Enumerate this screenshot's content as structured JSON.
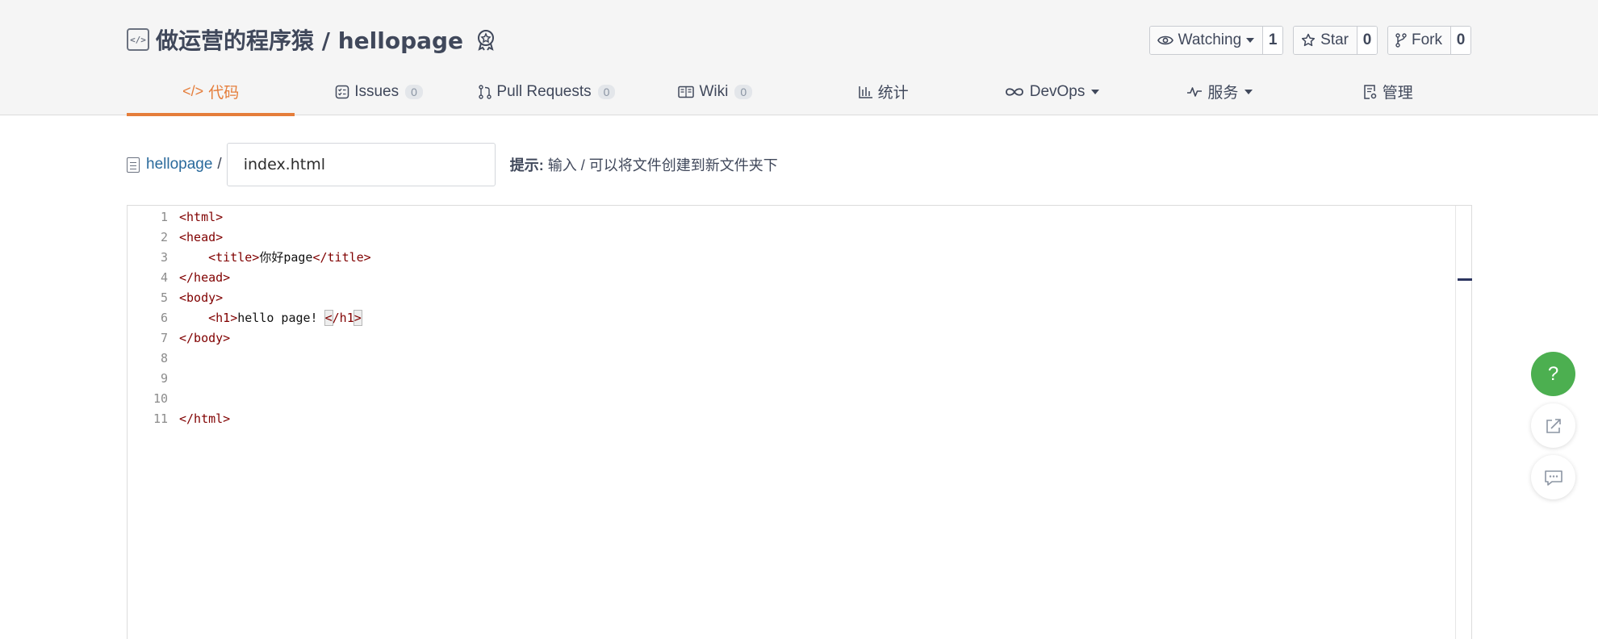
{
  "repo": {
    "owner_name": "做运营的程序猿 / hellopage",
    "icon": "code-icon",
    "badge_icon": "award-badge-icon"
  },
  "actions": {
    "watch": {
      "label": "Watching",
      "count": "1",
      "icon": "eye-icon"
    },
    "star": {
      "label": "Star",
      "count": "0",
      "icon": "star-icon"
    },
    "fork": {
      "label": "Fork",
      "count": "0",
      "icon": "fork-icon"
    }
  },
  "tabs": [
    {
      "label": "代码",
      "icon": "code-icon",
      "count": null,
      "active": true
    },
    {
      "label": "Issues",
      "icon": "issues-icon",
      "count": "0"
    },
    {
      "label": "Pull Requests",
      "icon": "pull-request-icon",
      "count": "0"
    },
    {
      "label": "Wiki",
      "icon": "book-icon",
      "count": "0"
    },
    {
      "label": "统计",
      "icon": "bar-chart-icon",
      "count": null
    },
    {
      "label": "DevOps",
      "icon": "infinity-icon",
      "count": null,
      "dropdown": true
    },
    {
      "label": "服务",
      "icon": "pulse-icon",
      "count": null,
      "dropdown": true
    },
    {
      "label": "管理",
      "icon": "settings-doc-icon",
      "count": null
    }
  ],
  "path": {
    "repo_link": "hellopage",
    "separator": "/",
    "filename_value": "index.html",
    "hint_bold": "提示:",
    "hint_text": " 输入 / 可以将文件创建到新文件夹下"
  },
  "editor": {
    "lines": [
      {
        "n": "1"
      },
      {
        "n": "2"
      },
      {
        "n": "3"
      },
      {
        "n": "4"
      },
      {
        "n": "5"
      },
      {
        "n": "6"
      },
      {
        "n": "7"
      },
      {
        "n": "8"
      },
      {
        "n": "9"
      },
      {
        "n": "10"
      },
      {
        "n": "11"
      }
    ],
    "code": {
      "l1_tag": "<html>",
      "l2_tag": "<head>",
      "l3_open": "<title>",
      "l3_text": "你好page",
      "l3_close": "</title>",
      "l4_tag": "</head>",
      "l5_tag": "<body>",
      "l6_open": "<h1>",
      "l6_text": "hello page! ",
      "l6_lt": "<",
      "l6_close": "/h1",
      "l6_gt": ">",
      "l7_tag": "</body>",
      "l11_tag": "</html>"
    }
  },
  "floating": {
    "help_label": "?",
    "share_icon": "share-icon",
    "comment_icon": "comment-icon"
  },
  "colors": {
    "accent": "#e57d3a",
    "help_green": "#4caf50",
    "link": "#2a6a9c",
    "tag": "#800000"
  }
}
